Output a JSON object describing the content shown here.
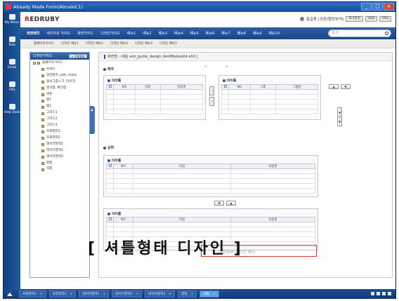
{
  "window": {
    "title": "Already Made Form(AlmaloC1)"
  },
  "leftbar": [
    {
      "label": "My Menu"
    },
    {
      "label": "Todo"
    },
    {
      "label": "Email"
    },
    {
      "label": "FAQ"
    },
    {
      "label": "Help Desk"
    }
  ],
  "header": {
    "logo_mark": "R",
    "logo_text": "EDRUBY",
    "user": "홍길동 (과장/행정부처)",
    "buttons": [
      "로그아웃",
      "VDS",
      "FAQ"
    ]
  },
  "nav": {
    "items": [
      "화면배치",
      "레이아웃 가이드",
      "화면가이드",
      "디자인가이드",
      "메뉴1",
      "메뉴2",
      "메뉴3",
      "메뉴4",
      "메뉴5",
      "메뉴6",
      "메뉴7",
      "메뉴8",
      "메뉴9",
      "메뉴10"
    ],
    "search_placeholder": "검색"
  },
  "subnav": {
    "items": [
      "홈페이지가이드",
      "디자인 메뉴1",
      "디자인 메뉴2",
      "디자인 메뉴3",
      "디자인 메뉴4",
      "디자인 메뉴5"
    ]
  },
  "sidebar": {
    "title": "디자인가이드",
    "button": "+ 전체펼침",
    "root": "홈페이지가이드",
    "items": [
      "static",
      "입력항목_edit, mask",
      "콤보그룹스크, 이미지",
      "경고창, 확인창",
      "버튼",
      "탭1",
      "탭2",
      "그리드1",
      "그리드2",
      "그리드3",
      "조회영역1",
      "조회영역2",
      "데이터영역1",
      "데이터영역2",
      "데이터영역3",
      "팝업",
      "셔틀"
    ]
  },
  "main": {
    "breadcrumb": "화면명 : 셔틀[ aml_guide_design::AmlModule04.xhtl ]",
    "top_section": "좌우",
    "left_panel": {
      "title": "타이틀",
      "cols": [
        "NO",
        "타입",
        "타입명"
      ]
    },
    "right_panel": {
      "title": "타이틀",
      "cols": [
        "NO",
        "그룹",
        "그룹명"
      ]
    },
    "bottom_section": "상하",
    "upper_panel": {
      "title": "타이틀",
      "cols": [
        "NO",
        "타입",
        "타입명"
      ]
    },
    "lower_panel": {
      "title": "타이틀",
      "cols": [
        "NO",
        "타입",
        "타입명"
      ]
    }
  },
  "overlay": {
    "caption": "[ 셔틀형태 디자인 ]",
    "highlight_text": "셔틀형태 디자인 제공"
  },
  "taskbar": {
    "tabs": [
      "조회영역1",
      "조회영역2",
      "데이터영역1",
      "데이터영역2",
      "데이터영역3",
      "팝업",
      "셔틀"
    ],
    "active_index": 6
  }
}
